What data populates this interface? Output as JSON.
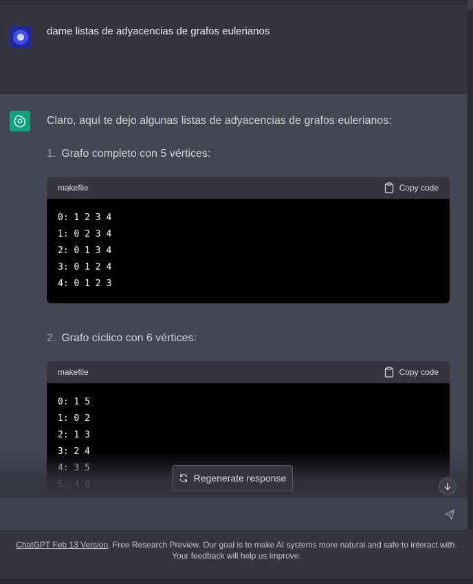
{
  "user": {
    "message": "dame listas de adyacencias de grafos eulerianos"
  },
  "assistant": {
    "intro": "Claro, aquí te dejo algunas listas de adyacencias de grafos eulerianos:",
    "items": [
      {
        "number": "1.",
        "title": "Grafo completo con 5 vértices:",
        "code_language": "makefile",
        "copy_label": "Copy code",
        "lines": [
          "0: 1 2 3 4",
          "1: 0 2 3 4",
          "2: 0 1 3 4",
          "3: 0 1 2 4",
          "4: 0 1 2 3"
        ]
      },
      {
        "number": "2.",
        "title": "Grafo cíclico con 6 vértices:",
        "code_language": "makefile",
        "copy_label": "Copy code",
        "lines": [
          "0: 1 5",
          "1: 0 2",
          "2: 1 3",
          "3: 2 4",
          "4: 3 5",
          "5: 4 0"
        ]
      }
    ]
  },
  "regenerate_label": "Regenerate response",
  "input": {
    "placeholder": ""
  },
  "footer": {
    "link_text": "ChatGPT Feb 13 Version",
    "text": ". Free Research Preview. Our goal is to make AI systems more natural and safe to interact with. Your feedback will help us improve."
  },
  "icons": {
    "user_avatar": "user-avatar-icon",
    "bot_avatar": "openai-logo-icon",
    "copy": "clipboard-icon",
    "regenerate": "refresh-icon",
    "scroll_down": "arrow-down-icon",
    "send": "send-icon"
  },
  "colors": {
    "background": "#343541",
    "assistant_background": "#444654",
    "bot_avatar": "#10a37f",
    "code_background": "#000000"
  }
}
